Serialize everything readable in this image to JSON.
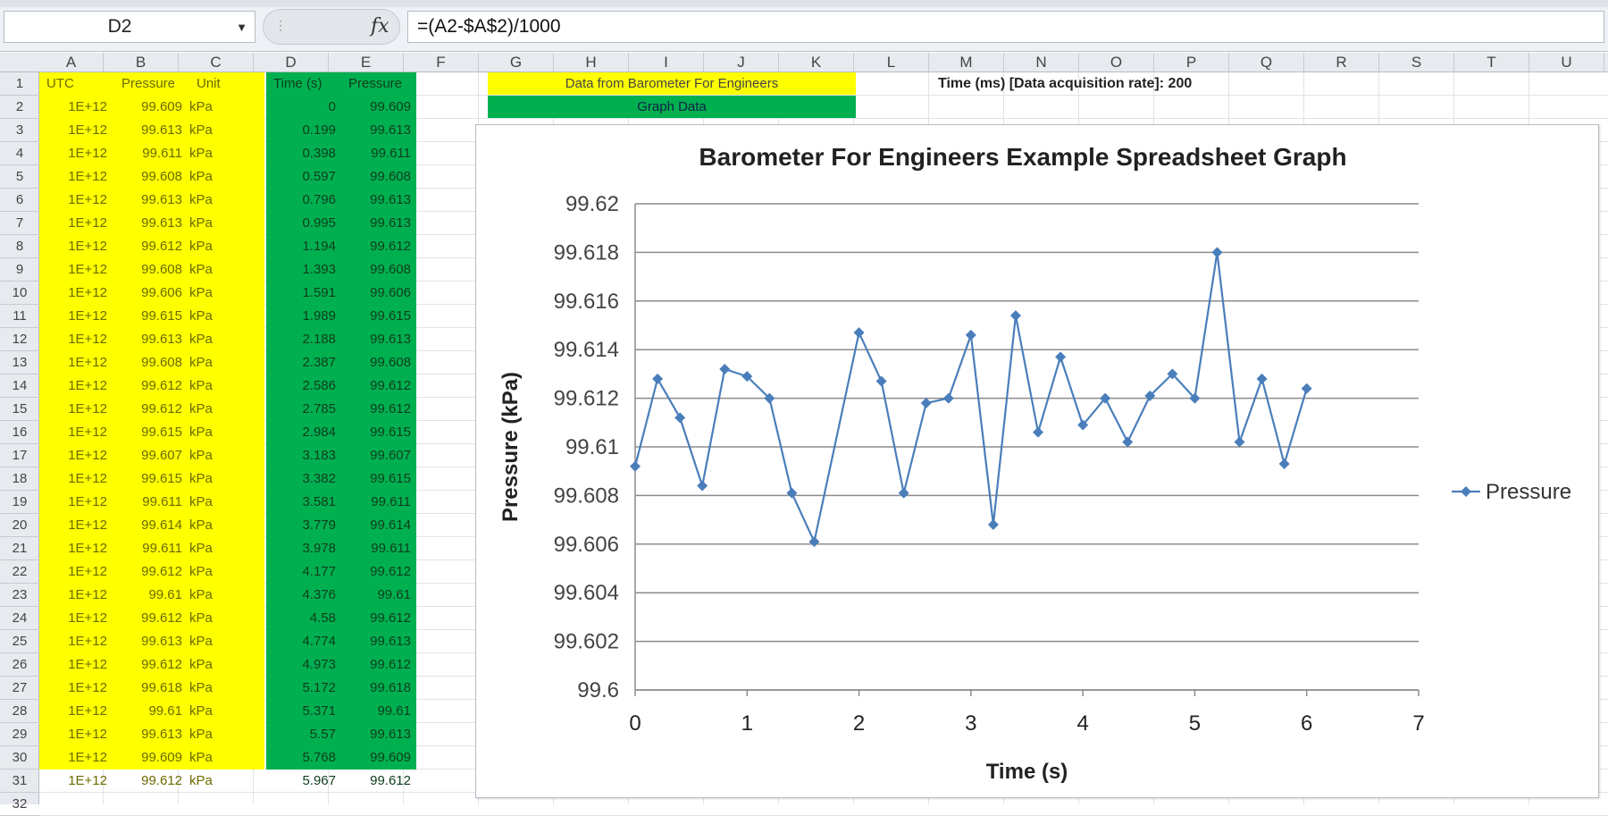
{
  "formula_bar": {
    "name_box": "D2",
    "formula": "=(A2-$A$2)/1000",
    "fx_label": "fx",
    "dots": "⋮"
  },
  "columns": [
    "A",
    "B",
    "C",
    "D",
    "E",
    "F",
    "G",
    "H",
    "I",
    "J",
    "K",
    "L",
    "M",
    "N",
    "O",
    "P",
    "Q",
    "R",
    "S",
    "T",
    "U"
  ],
  "rows": [
    "1",
    "2",
    "3",
    "4",
    "5",
    "6",
    "7",
    "8",
    "9",
    "10",
    "11",
    "12",
    "13",
    "14",
    "15",
    "16",
    "17",
    "18",
    "19",
    "20",
    "21",
    "22",
    "23",
    "24",
    "25",
    "26",
    "27",
    "28",
    "29",
    "30",
    "31",
    "32"
  ],
  "headers": {
    "utc": "UTC",
    "pressure_b": "Pressure",
    "unit": "Unit",
    "time": "Time (s)",
    "pressure_e": "Pressure"
  },
  "banners": {
    "data_from": "Data from Barometer For Engineers",
    "graph_data": "Graph Data",
    "acquisition_label": "Time (ms) [Data acquisition rate]:",
    "acquisition_value": "200"
  },
  "table": [
    {
      "utc": "1E+12",
      "pressure": "99.609",
      "unit": "kPa",
      "time": "0",
      "p": "99.609"
    },
    {
      "utc": "1E+12",
      "pressure": "99.613",
      "unit": "kPa",
      "time": "0.199",
      "p": "99.613"
    },
    {
      "utc": "1E+12",
      "pressure": "99.611",
      "unit": "kPa",
      "time": "0.398",
      "p": "99.611"
    },
    {
      "utc": "1E+12",
      "pressure": "99.608",
      "unit": "kPa",
      "time": "0.597",
      "p": "99.608"
    },
    {
      "utc": "1E+12",
      "pressure": "99.613",
      "unit": "kPa",
      "time": "0.796",
      "p": "99.613"
    },
    {
      "utc": "1E+12",
      "pressure": "99.613",
      "unit": "kPa",
      "time": "0.995",
      "p": "99.613"
    },
    {
      "utc": "1E+12",
      "pressure": "99.612",
      "unit": "kPa",
      "time": "1.194",
      "p": "99.612"
    },
    {
      "utc": "1E+12",
      "pressure": "99.608",
      "unit": "kPa",
      "time": "1.393",
      "p": "99.608"
    },
    {
      "utc": "1E+12",
      "pressure": "99.606",
      "unit": "kPa",
      "time": "1.591",
      "p": "99.606"
    },
    {
      "utc": "1E+12",
      "pressure": "99.615",
      "unit": "kPa",
      "time": "1.989",
      "p": "99.615"
    },
    {
      "utc": "1E+12",
      "pressure": "99.613",
      "unit": "kPa",
      "time": "2.188",
      "p": "99.613"
    },
    {
      "utc": "1E+12",
      "pressure": "99.608",
      "unit": "kPa",
      "time": "2.387",
      "p": "99.608"
    },
    {
      "utc": "1E+12",
      "pressure": "99.612",
      "unit": "kPa",
      "time": "2.586",
      "p": "99.612"
    },
    {
      "utc": "1E+12",
      "pressure": "99.612",
      "unit": "kPa",
      "time": "2.785",
      "p": "99.612"
    },
    {
      "utc": "1E+12",
      "pressure": "99.615",
      "unit": "kPa",
      "time": "2.984",
      "p": "99.615"
    },
    {
      "utc": "1E+12",
      "pressure": "99.607",
      "unit": "kPa",
      "time": "3.183",
      "p": "99.607"
    },
    {
      "utc": "1E+12",
      "pressure": "99.615",
      "unit": "kPa",
      "time": "3.382",
      "p": "99.615"
    },
    {
      "utc": "1E+12",
      "pressure": "99.611",
      "unit": "kPa",
      "time": "3.581",
      "p": "99.611"
    },
    {
      "utc": "1E+12",
      "pressure": "99.614",
      "unit": "kPa",
      "time": "3.779",
      "p": "99.614"
    },
    {
      "utc": "1E+12",
      "pressure": "99.611",
      "unit": "kPa",
      "time": "3.978",
      "p": "99.611"
    },
    {
      "utc": "1E+12",
      "pressure": "99.612",
      "unit": "kPa",
      "time": "4.177",
      "p": "99.612"
    },
    {
      "utc": "1E+12",
      "pressure": "99.61",
      "unit": "kPa",
      "time": "4.376",
      "p": "99.61"
    },
    {
      "utc": "1E+12",
      "pressure": "99.612",
      "unit": "kPa",
      "time": "4.58",
      "p": "99.612"
    },
    {
      "utc": "1E+12",
      "pressure": "99.613",
      "unit": "kPa",
      "time": "4.774",
      "p": "99.613"
    },
    {
      "utc": "1E+12",
      "pressure": "99.612",
      "unit": "kPa",
      "time": "4.973",
      "p": "99.612"
    },
    {
      "utc": "1E+12",
      "pressure": "99.618",
      "unit": "kPa",
      "time": "5.172",
      "p": "99.618"
    },
    {
      "utc": "1E+12",
      "pressure": "99.61",
      "unit": "kPa",
      "time": "5.371",
      "p": "99.61"
    },
    {
      "utc": "1E+12",
      "pressure": "99.613",
      "unit": "kPa",
      "time": "5.57",
      "p": "99.613"
    },
    {
      "utc": "1E+12",
      "pressure": "99.609",
      "unit": "kPa",
      "time": "5.768",
      "p": "99.609"
    },
    {
      "utc": "1E+12",
      "pressure": "99.612",
      "unit": "kPa",
      "time": "5.967",
      "p": "99.612"
    }
  ],
  "colors": {
    "yellow": "#ffff00",
    "green": "#00b050",
    "series": "#4a7ebb"
  },
  "chart_data": {
    "type": "line",
    "title": "Barometer For Engineers Example Spreadsheet Graph",
    "xlabel": "Time (s)",
    "ylabel": "Pressure (kPa)",
    "xlim": [
      0,
      7
    ],
    "ylim": [
      99.6,
      99.62
    ],
    "x_ticks": [
      "0",
      "1",
      "2",
      "3",
      "4",
      "5",
      "6",
      "7"
    ],
    "y_ticks": [
      "99.6",
      "99.602",
      "99.604",
      "99.606",
      "99.608",
      "99.61",
      "99.612",
      "99.614",
      "99.616",
      "99.618",
      "99.62"
    ],
    "grid": true,
    "legend_position": "right",
    "series": [
      {
        "name": "Pressure",
        "x": [
          0,
          0.2,
          0.4,
          0.6,
          0.8,
          1.0,
          1.2,
          1.4,
          1.6,
          2.0,
          2.2,
          2.4,
          2.6,
          2.8,
          3.0,
          3.2,
          3.4,
          3.6,
          3.8,
          4.0,
          4.2,
          4.4,
          4.6,
          4.8,
          5.0,
          5.2,
          5.4,
          5.6,
          5.8,
          6.0
        ],
        "values": [
          99.6092,
          99.6128,
          99.6112,
          99.6084,
          99.6132,
          99.6129,
          99.612,
          99.6081,
          99.6061,
          99.6147,
          99.6127,
          99.6081,
          99.6118,
          99.612,
          99.6146,
          99.6068,
          99.6154,
          99.6106,
          99.6137,
          99.6109,
          99.612,
          99.6102,
          99.6121,
          99.613,
          99.612,
          99.618,
          99.6102,
          99.6128,
          99.6093,
          99.6124
        ]
      }
    ]
  }
}
